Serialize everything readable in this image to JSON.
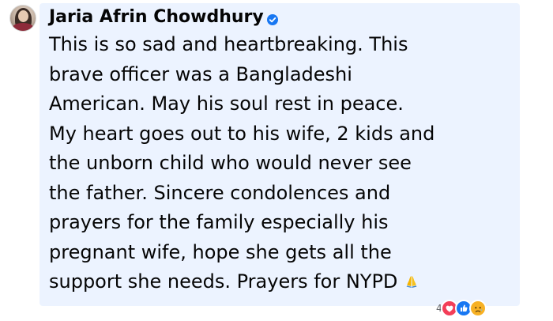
{
  "comment": {
    "author": "Jaria Afrin Chowdhury",
    "verified_icon": "verified-badge-icon",
    "text_lines": [
      "This is so sad and heartbreaking. This",
      "brave officer was a Bangladeshi",
      "American. May his soul rest in peace.",
      "My heart goes out to his wife, 2 kids and",
      "the unborn child who would never see",
      "the father. Sincere condolences and",
      "prayers for the family especially his",
      "pregnant wife, hope she gets all the",
      "support she needs. Prayers for NYPD"
    ],
    "trailing_emoji": "folded-hands-icon"
  },
  "reactions": {
    "count": "4",
    "icons": [
      "love-reaction-icon",
      "like-reaction-icon",
      "sad-reaction-icon"
    ]
  },
  "colors": {
    "bubble_bg": "#ecf3ff",
    "text": "#050505",
    "verified": "#1877f2",
    "love": "#f33e58",
    "like": "#1877f2",
    "sad": "#f7b125"
  }
}
